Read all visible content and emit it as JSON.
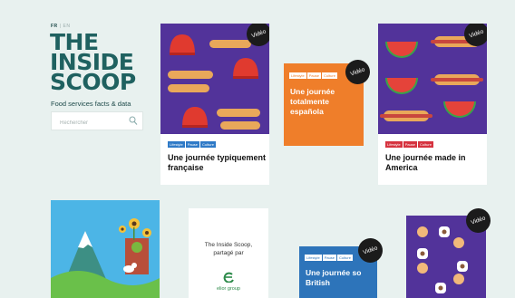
{
  "lang": {
    "active": "FR",
    "other": "EN"
  },
  "logo": {
    "line1": "THE",
    "line2": "INSIDE",
    "line3": "SCOOP"
  },
  "tagline": "Food services facts & data",
  "search": {
    "placeholder": "Rechercher"
  },
  "video_label": "Vidéo",
  "tags": {
    "lifestyle": "Lifestyle",
    "pause": "Pause",
    "culture": "Culture"
  },
  "cards": {
    "france": {
      "title": "Une journée typiquement française"
    },
    "espanola": {
      "title": "Une journée totalmente española"
    },
    "america": {
      "title": "Une journée made in America"
    },
    "promo": {
      "text": "The Inside Scoop, partagé par",
      "brand": "elior group"
    },
    "british": {
      "title": "Une journée so British"
    }
  },
  "colors": {
    "background": "#e8f1ef",
    "logo": "#1f6160",
    "purple": "#52339a",
    "orange": "#ef7e2a",
    "blue": "#2d74ba",
    "red_tag": "#d6333f",
    "blue_tag": "#2f7ac7"
  }
}
